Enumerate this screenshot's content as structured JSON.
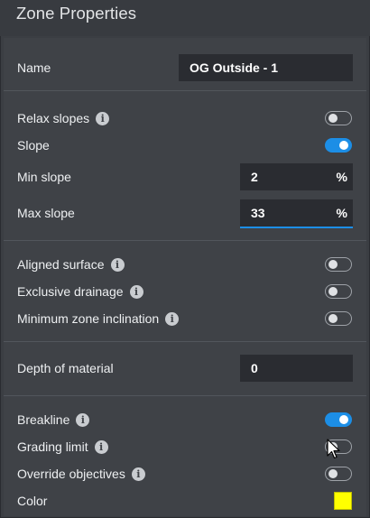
{
  "panel": {
    "title": "Zone Properties"
  },
  "name_field": {
    "label": "Name",
    "value": "OG Outside - 1"
  },
  "relax_slopes": {
    "label": "Relax slopes",
    "on": false
  },
  "slope": {
    "label": "Slope",
    "on": true
  },
  "min_slope": {
    "label": "Min slope",
    "value": "2",
    "unit": "%"
  },
  "max_slope": {
    "label": "Max slope",
    "value": "33",
    "unit": "%"
  },
  "aligned_surface": {
    "label": "Aligned surface",
    "on": false
  },
  "exclusive_drainage": {
    "label": "Exclusive drainage",
    "on": false
  },
  "minimum_zone_inclination": {
    "label": "Minimum zone inclination",
    "on": false
  },
  "depth_of_material": {
    "label": "Depth of material",
    "value": "0"
  },
  "breakline": {
    "label": "Breakline",
    "on": true
  },
  "grading_limit": {
    "label": "Grading limit",
    "on": false
  },
  "override_objectives": {
    "label": "Override objectives",
    "on": false
  },
  "color_row": {
    "label": "Color",
    "value": "#ffff00"
  },
  "icons": {
    "info": "info-icon",
    "cursor": "mouse-pointer-icon"
  },
  "colors": {
    "accent": "#1c8ee6",
    "panel": "#3f4247",
    "field": "#2a2c31"
  }
}
